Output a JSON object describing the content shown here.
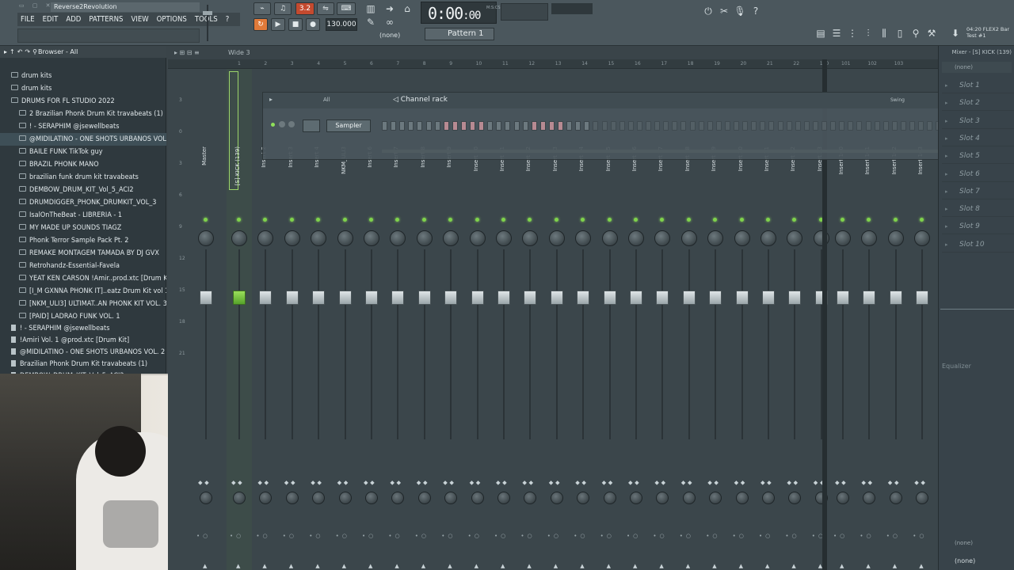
{
  "window": {
    "title": "Reverse2Revolution"
  },
  "menu": [
    "FILE",
    "EDIT",
    "ADD",
    "PATTERNS",
    "VIEW",
    "OPTIONS",
    "TOOLS",
    "?"
  ],
  "transport": {
    "pattern_song_label": "3.2",
    "tempo": "130.000",
    "time": "0:00",
    "time_frac": "00",
    "time_unit": "M:S:CS",
    "pattern": "Pattern 1",
    "none_label": "(none)"
  },
  "right_info": {
    "line1": "04:20  FLEX2 Bar",
    "line2": "Test #1"
  },
  "browser": {
    "title": "Browser - All",
    "items": [
      {
        "label": "drum kits",
        "type": "folder",
        "level": 1
      },
      {
        "label": "drum kits",
        "type": "folder",
        "level": 1
      },
      {
        "label": "DRUMS FOR FL STUDIO 2022",
        "type": "folder-open",
        "level": 1
      },
      {
        "label": "2 Brazilian Phonk Drum Kit travabeats (1)",
        "type": "folder",
        "level": 2
      },
      {
        "label": "! - SERAPHIM @jsewellbeats",
        "type": "folder",
        "level": 2
      },
      {
        "label": "@MIDILATINO - ONE SHOTS URBANOS VOL. 2",
        "type": "folder",
        "level": 2,
        "selected": true
      },
      {
        "label": "BAILE FUNK TikTok guy",
        "type": "folder",
        "level": 2
      },
      {
        "label": "BRAZIL PHONK MANO",
        "type": "folder",
        "level": 2
      },
      {
        "label": "brazilian funk drum kit travabeats",
        "type": "folder",
        "level": 2
      },
      {
        "label": "DEMBOW_DRUM_KIT_Vol_5_ACI2",
        "type": "folder",
        "level": 2
      },
      {
        "label": "DRUMDIGGER_PHONK_DRUMKIT_VOL_3",
        "type": "folder",
        "level": 2
      },
      {
        "label": "IsalOnTheBeat - LIBRERIA - 1",
        "type": "folder",
        "level": 2
      },
      {
        "label": "MY MADE UP SOUNDS TIAGZ",
        "type": "folder",
        "level": 2
      },
      {
        "label": "Phonk Terror Sample Pack Pt. 2",
        "type": "folder",
        "level": 2
      },
      {
        "label": "REMAKE MONTAGEM TAMADA BY DJ GVX",
        "type": "folder",
        "level": 2
      },
      {
        "label": "Retrohandz-Essential-Favela",
        "type": "folder",
        "level": 2
      },
      {
        "label": "YEAT KEN CARSON !Amir..prod.xtc [Drum Kit]",
        "type": "folder",
        "level": 2
      },
      {
        "label": "[I_M GXNNA PHONK IT]..eatz Drum Kit vol 1",
        "type": "folder",
        "level": 2
      },
      {
        "label": "[NKM_ULI3] ULTIMAT..AN PHONK KIT VOL. 3",
        "type": "folder",
        "level": 2
      },
      {
        "label": "[PAID] LADRAO FUNK VOL. 1",
        "type": "folder",
        "level": 2
      },
      {
        "label": "! - SERAPHIM @jsewellbeats",
        "type": "file",
        "level": 1
      },
      {
        "label": "!Amiri Vol. 1 @prod.xtc [Drum Kit]",
        "type": "file",
        "level": 1
      },
      {
        "label": "@MIDILATINO - ONE SHOTS URBANOS VOL. 2",
        "type": "file",
        "level": 1
      },
      {
        "label": "Brazilian Phonk Drum Kit travabeats (1)",
        "type": "file",
        "level": 1
      },
      {
        "label": "DEMBOW_DRUM_KIT_Vol_5_ACI2",
        "type": "file",
        "level": 1
      }
    ]
  },
  "mixer": {
    "view_label": "Wide 3",
    "head_labels": [
      "Current",
      "Master"
    ],
    "ruler": [
      "1",
      "2",
      "3",
      "4",
      "5",
      "6",
      "7",
      "8",
      "9",
      "10",
      "11",
      "12",
      "13",
      "14",
      "15",
      "16",
      "17",
      "18",
      "19",
      "20",
      "21",
      "22",
      "100",
      "101",
      "102",
      "103"
    ],
    "scale": [
      "3",
      "0",
      "3",
      "6",
      "9",
      "12",
      "15",
      "18",
      "21"
    ],
    "strips": [
      {
        "name": "Master"
      },
      {
        "name": "[S] KICK (139)",
        "selected": true
      },
      {
        "name": "Insert 2"
      },
      {
        "name": "Insert 3"
      },
      {
        "name": "Insert 4"
      },
      {
        "name": "NKM_ULI3"
      },
      {
        "name": "Insert 6"
      },
      {
        "name": "Insert 7"
      },
      {
        "name": "Insert 8"
      },
      {
        "name": "Insert 9"
      },
      {
        "name": "Insert 10"
      },
      {
        "name": "Insert 11"
      },
      {
        "name": "Insert 12"
      },
      {
        "name": "Insert 13"
      },
      {
        "name": "Insert 14"
      },
      {
        "name": "Insert 15"
      },
      {
        "name": "Insert 16"
      },
      {
        "name": "Insert 17"
      },
      {
        "name": "Insert 18"
      },
      {
        "name": "Insert 19"
      },
      {
        "name": "Insert 20"
      },
      {
        "name": "Insert 21"
      },
      {
        "name": "Insert 22"
      },
      {
        "name": "Insert 23"
      },
      {
        "name": "Insert 100"
      },
      {
        "name": "Insert 101"
      },
      {
        "name": "Insert 102"
      },
      {
        "name": "Insert 103"
      }
    ]
  },
  "channel_rack": {
    "title": "Channel rack",
    "filter": "All",
    "swing": "Swing",
    "channel": "Sampler",
    "steps": 64,
    "pink_steps": [
      7,
      8,
      9,
      10,
      11,
      17,
      18,
      19,
      20
    ]
  },
  "fx_panel": {
    "title": "Mixer - [S] KICK (139)",
    "input": "(none)",
    "slots": [
      "Slot 1",
      "Slot 2",
      "Slot 3",
      "Slot 4",
      "Slot 5",
      "Slot 6",
      "Slot 7",
      "Slot 8",
      "Slot 9",
      "Slot 10"
    ],
    "eq_label": "Equalizer",
    "output_a": "(none)",
    "output_b": "(none)"
  }
}
